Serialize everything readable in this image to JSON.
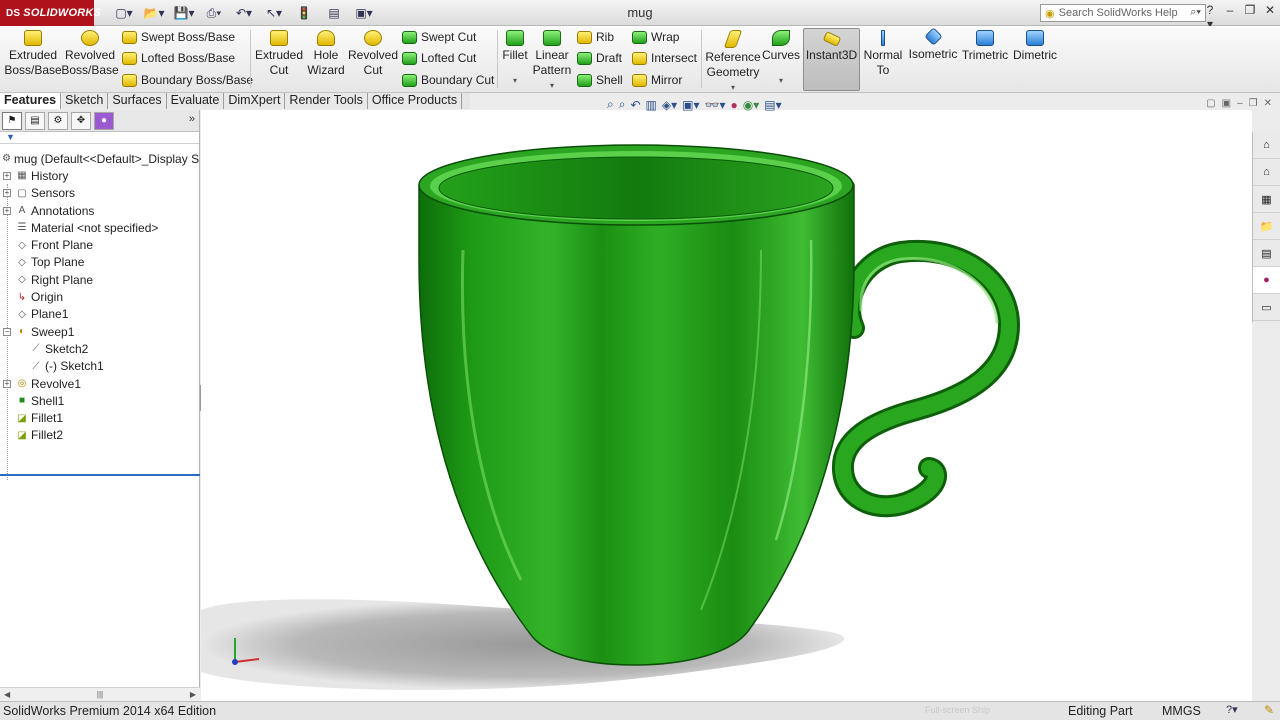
{
  "window": {
    "title": "mug",
    "logo_text": "SOLIDWORKS",
    "search_placeholder": "Search SolidWorks Help"
  },
  "commandmanager": {
    "extruded_boss": "Extruded\nBoss/Base",
    "revolved_boss": "Revolved\nBoss/Base",
    "swept_boss": "Swept Boss/Base",
    "lofted_boss": "Lofted Boss/Base",
    "boundary_boss": "Boundary Boss/Base",
    "extruded_cut": "Extruded\nCut",
    "hole_wizard": "Hole\nWizard",
    "revolved_cut": "Revolved\nCut",
    "swept_cut": "Swept Cut",
    "lofted_cut": "Lofted Cut",
    "boundary_cut": "Boundary Cut",
    "fillet": "Fillet",
    "linear_pattern": "Linear\nPattern",
    "rib": "Rib",
    "draft": "Draft",
    "shell": "Shell",
    "wrap": "Wrap",
    "intersect": "Intersect",
    "mirror": "Mirror",
    "reference_geometry": "Reference\nGeometry",
    "curves": "Curves",
    "instant3d": "Instant3D",
    "normal_to": "Normal\nTo",
    "isometric": "Isometric",
    "trimetric": "Trimetric",
    "dimetric": "Dimetric"
  },
  "tabs": [
    {
      "label": "Features"
    },
    {
      "label": "Sketch"
    },
    {
      "label": "Surfaces"
    },
    {
      "label": "Evaluate"
    },
    {
      "label": "DimXpert"
    },
    {
      "label": "Render Tools"
    },
    {
      "label": "Office Products"
    }
  ],
  "tree": {
    "root": "mug  (Default<<Default>_Display S",
    "items": [
      {
        "label": "History"
      },
      {
        "label": "Sensors"
      },
      {
        "label": "Annotations"
      },
      {
        "label": "Material <not specified>"
      },
      {
        "label": "Front Plane"
      },
      {
        "label": "Top Plane"
      },
      {
        "label": "Right Plane"
      },
      {
        "label": "Origin"
      },
      {
        "label": "Plane1"
      },
      {
        "label": "Sweep1"
      },
      {
        "label": "Sketch2"
      },
      {
        "label": "(-) Sketch1"
      },
      {
        "label": "Revolve1"
      },
      {
        "label": "Shell1"
      },
      {
        "label": "Fillet1"
      },
      {
        "label": "Fillet2"
      }
    ]
  },
  "status": {
    "edition": "SolidWorks Premium 2014 x64 Edition",
    "hint": "Full-screen Ship",
    "mode": "Editing Part",
    "units": "MMGS"
  },
  "model": {
    "color": "#1f9a16",
    "color_dark": "#0b5a08",
    "color_light": "#7fe46a"
  }
}
